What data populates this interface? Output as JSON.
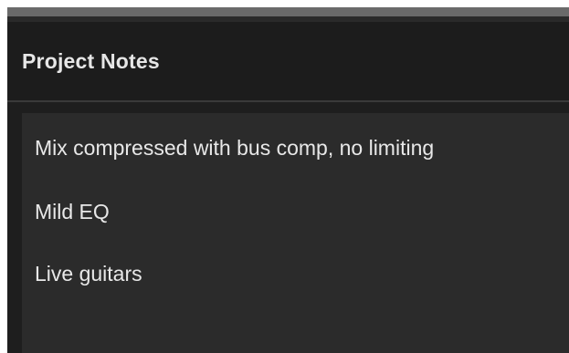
{
  "panel": {
    "title": "Project Notes"
  },
  "notes": {
    "lines": [
      "Mix compressed with bus comp, no limiting",
      "Mild EQ",
      "Live guitars"
    ]
  }
}
